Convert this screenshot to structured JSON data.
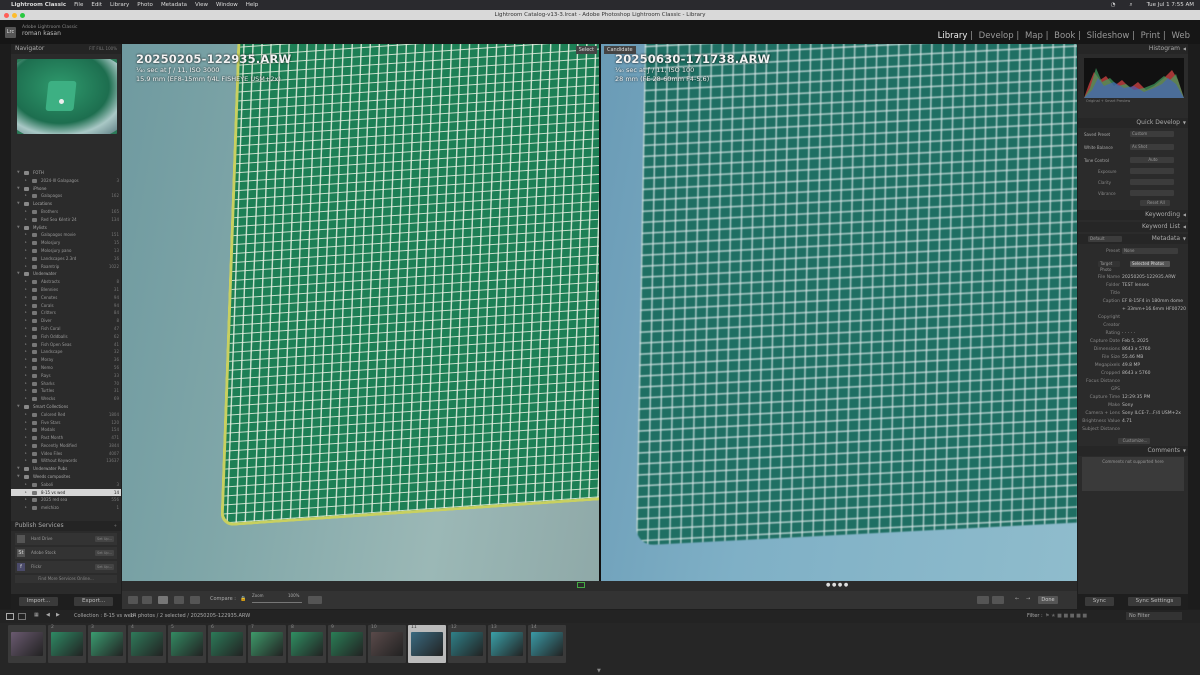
{
  "menubar": {
    "app": "Lightroom Classic",
    "items": [
      "File",
      "Edit",
      "Library",
      "Photo",
      "Metadata",
      "View",
      "Window",
      "Help"
    ],
    "clock": "Tue Jul 1  7:55 AM"
  },
  "window": {
    "title": "Lightroom Catalog-v13-3.lrcat - Adobe Photoshop Lightroom Classic - Library"
  },
  "identity": {
    "logo": "Lrc",
    "product": "Adobe Lightroom Classic",
    "user": "roman kasan"
  },
  "modules": {
    "items": [
      "Library",
      "Develop",
      "Map",
      "Book",
      "Slideshow",
      "Print",
      "Web"
    ],
    "active": "Library"
  },
  "navigator": {
    "title": "Navigator",
    "options": "FIT  FILL  100%"
  },
  "collections": {
    "rows": [
      {
        "label": "FOTH",
        "count": "",
        "set": true
      },
      {
        "label": "2024-III Galapagos",
        "count": "3",
        "set": false
      },
      {
        "label": "iPhone",
        "count": "",
        "set": true
      },
      {
        "label": "Galapagos",
        "count": "162",
        "set": false
      },
      {
        "label": "Locations",
        "count": "",
        "set": true
      },
      {
        "label": "Brothers",
        "count": "165",
        "set": false
      },
      {
        "label": "Red Sea Kéntir 24",
        "count": "134",
        "set": false
      },
      {
        "label": "Mylists",
        "count": "",
        "set": true
      },
      {
        "label": "Galapagos movie",
        "count": "151",
        "set": false
      },
      {
        "label": "Molosjury",
        "count": "15",
        "set": false
      },
      {
        "label": "Molosjury pano",
        "count": "13",
        "set": false
      },
      {
        "label": "Landscapes 2.3rd",
        "count": "16",
        "set": false
      },
      {
        "label": "Roamtrip",
        "count": "1022",
        "set": false
      },
      {
        "label": "Underwater",
        "count": "",
        "set": true
      },
      {
        "label": "Abstracts",
        "count": "8",
        "set": false
      },
      {
        "label": "Blennies",
        "count": "31",
        "set": false
      },
      {
        "label": "Cenotes",
        "count": "94",
        "set": false
      },
      {
        "label": "Corals",
        "count": "94",
        "set": false
      },
      {
        "label": "Critters",
        "count": "84",
        "set": false
      },
      {
        "label": "Diver",
        "count": "8",
        "set": false
      },
      {
        "label": "Fish Coral",
        "count": "47",
        "set": false
      },
      {
        "label": "Fish Oddballs",
        "count": "62",
        "set": false
      },
      {
        "label": "Fish Open Seas",
        "count": "41",
        "set": false
      },
      {
        "label": "Landscape",
        "count": "32",
        "set": false
      },
      {
        "label": "Moray",
        "count": "36",
        "set": false
      },
      {
        "label": "Nemo",
        "count": "56",
        "set": false
      },
      {
        "label": "Rays",
        "count": "33",
        "set": false
      },
      {
        "label": "Sharks",
        "count": "70",
        "set": false
      },
      {
        "label": "Turtles",
        "count": "31",
        "set": false
      },
      {
        "label": "Wrecks",
        "count": "69",
        "set": false
      },
      {
        "label": "Smart Collections",
        "count": "",
        "set": true
      },
      {
        "label": "Colored Red",
        "count": "1804",
        "set": false
      },
      {
        "label": "Five Stars",
        "count": "120",
        "set": false
      },
      {
        "label": "Modals",
        "count": "154",
        "set": false
      },
      {
        "label": "Past Month",
        "count": "471",
        "set": false
      },
      {
        "label": "Recently Modified",
        "count": "3844",
        "set": false
      },
      {
        "label": "Video Files",
        "count": "4007",
        "set": false
      },
      {
        "label": "Without Keywords",
        "count": "13637",
        "set": false
      },
      {
        "label": "Underwater Pubs",
        "count": "",
        "set": true
      },
      {
        "label": "Weeds composites",
        "count": "",
        "set": true
      },
      {
        "label": "Saboli",
        "count": "3",
        "set": false
      },
      {
        "label": "8-15 vs wed",
        "count": "14",
        "set": false,
        "selected": true
      },
      {
        "label": "2025 red sea",
        "count": "556",
        "set": false
      },
      {
        "label": "melchizo",
        "count": "1",
        "set": false
      }
    ]
  },
  "publish": {
    "title": "Publish Services",
    "services": [
      {
        "logo": "",
        "label": "Hard Drive",
        "tag": "Set Up..."
      },
      {
        "logo": "St",
        "label": "Adobe Stock",
        "tag": "Set Up..."
      },
      {
        "logo": "f",
        "label": "Flickr",
        "tag": "Set Up..."
      }
    ],
    "find_more": "Find More Services Online..."
  },
  "left_buttons": {
    "import": "Import...",
    "export": "Export..."
  },
  "compare": {
    "left": {
      "badge": "Select",
      "filename": "20250205-122935.ARW",
      "exposure": "⅟₄₀ sec at ƒ / 11, ISO 3000",
      "lens": "15.9 mm (EF8-15mm f/4L FISHEYE USM+2x)"
    },
    "right": {
      "badge": "Candidate",
      "filename": "20250630-171738.ARW",
      "exposure": "⅟₄₀ sec at ƒ / 11, ISO 100",
      "lens": "28 mm (FE 28-60mm F4-5.6)"
    },
    "dots": "● ● ● ●"
  },
  "toolbar": {
    "compare_label": "Compare :",
    "zoom_label": "Zoom",
    "zoom_value": "100%",
    "done": "Done",
    "swap": "XY",
    "make": "⇄"
  },
  "right_panel": {
    "histogram": "Histogram",
    "histo_info": "Original + Smart Preview",
    "quick_develop": "Quick Develop",
    "saved_preset_label": "Saved Preset",
    "saved_preset_value": "Custom",
    "white_balance_label": "White Balance",
    "white_balance_value": "As Shot",
    "tone_control_label": "Tone Control",
    "tone_auto": "Auto",
    "exposure_label": "Exposure",
    "clarity_label": "Clarity",
    "vibrance_label": "Vibrance",
    "reset_all": "Reset All",
    "keywording": "Keywording",
    "keyword_list": "Keyword List",
    "metadata": "Metadata",
    "metadata_preset": "Default",
    "preset_label": "Preset",
    "preset_value": "None",
    "target_label": "Target Photo",
    "target_value": "Selected Photos",
    "fields": [
      {
        "k": "File Name",
        "v": "20250205-122935.ARW"
      },
      {
        "k": "Folder",
        "v": "TEST lenses"
      },
      {
        "k": "Title",
        "v": ""
      },
      {
        "k": "Caption",
        "v": "EF 8-15F4 in 180mm dome"
      },
      {
        "k": "",
        "v": "+ 33mm+16.6mm HF00720"
      },
      {
        "k": "Copyright",
        "v": ""
      },
      {
        "k": "Creator",
        "v": ""
      },
      {
        "k": "Rating",
        "v": "· · · · ·"
      },
      {
        "k": "Capture Date",
        "v": "Feb 5, 2025"
      },
      {
        "k": "Dimensions",
        "v": "8643 x 5760"
      },
      {
        "k": "File Size",
        "v": "55.46 MB"
      },
      {
        "k": "Megapixels",
        "v": "49.8 MP"
      },
      {
        "k": "Cropped",
        "v": "8643 x 5760"
      },
      {
        "k": "Focus Distance",
        "v": ""
      },
      {
        "k": "GPS",
        "v": ""
      },
      {
        "k": "Capture Time",
        "v": "12:29:35 PM"
      },
      {
        "k": "Make",
        "v": "Sony"
      },
      {
        "k": "Camera + Lens",
        "v": "Sony ILCE-7...F/4 USM+2x"
      },
      {
        "k": "Brightness Value",
        "v": "4.71"
      },
      {
        "k": "Subject Distance",
        "v": ""
      }
    ],
    "customize": "Customize...",
    "comments": "Comments",
    "comments_placeholder": "Comments not supported here"
  },
  "right_buttons": {
    "sync": "Sync",
    "sync_settings": "Sync Settings"
  },
  "filmbar": {
    "pages": "1 2",
    "source": "Collection : 8-15 vs wed",
    "count": "14 photos / 2 selected / 20250205-122935.ARW",
    "filter_label": "Filter :",
    "filter_value": "No Filter"
  },
  "filmstrip": {
    "cells": [
      {
        "n": "",
        "color": "#6a5a70"
      },
      {
        "n": "2",
        "color": "#2e8a64"
      },
      {
        "n": "3",
        "color": "#3a9c70"
      },
      {
        "n": "4",
        "color": "#2f7a5a"
      },
      {
        "n": "5",
        "color": "#338a62"
      },
      {
        "n": "6",
        "color": "#2c7a58"
      },
      {
        "n": "7",
        "color": "#3e9a6a"
      },
      {
        "n": "8",
        "color": "#2f8f62"
      },
      {
        "n": "9",
        "color": "#2a7e56"
      },
      {
        "n": "10",
        "color": "#5a4a4a"
      },
      {
        "n": "11",
        "color": "#3a6a80",
        "selected": true
      },
      {
        "n": "12",
        "color": "#2f8088"
      },
      {
        "n": "13",
        "color": "#3aa0a8"
      },
      {
        "n": "14",
        "color": "#3a9aa6"
      }
    ]
  }
}
